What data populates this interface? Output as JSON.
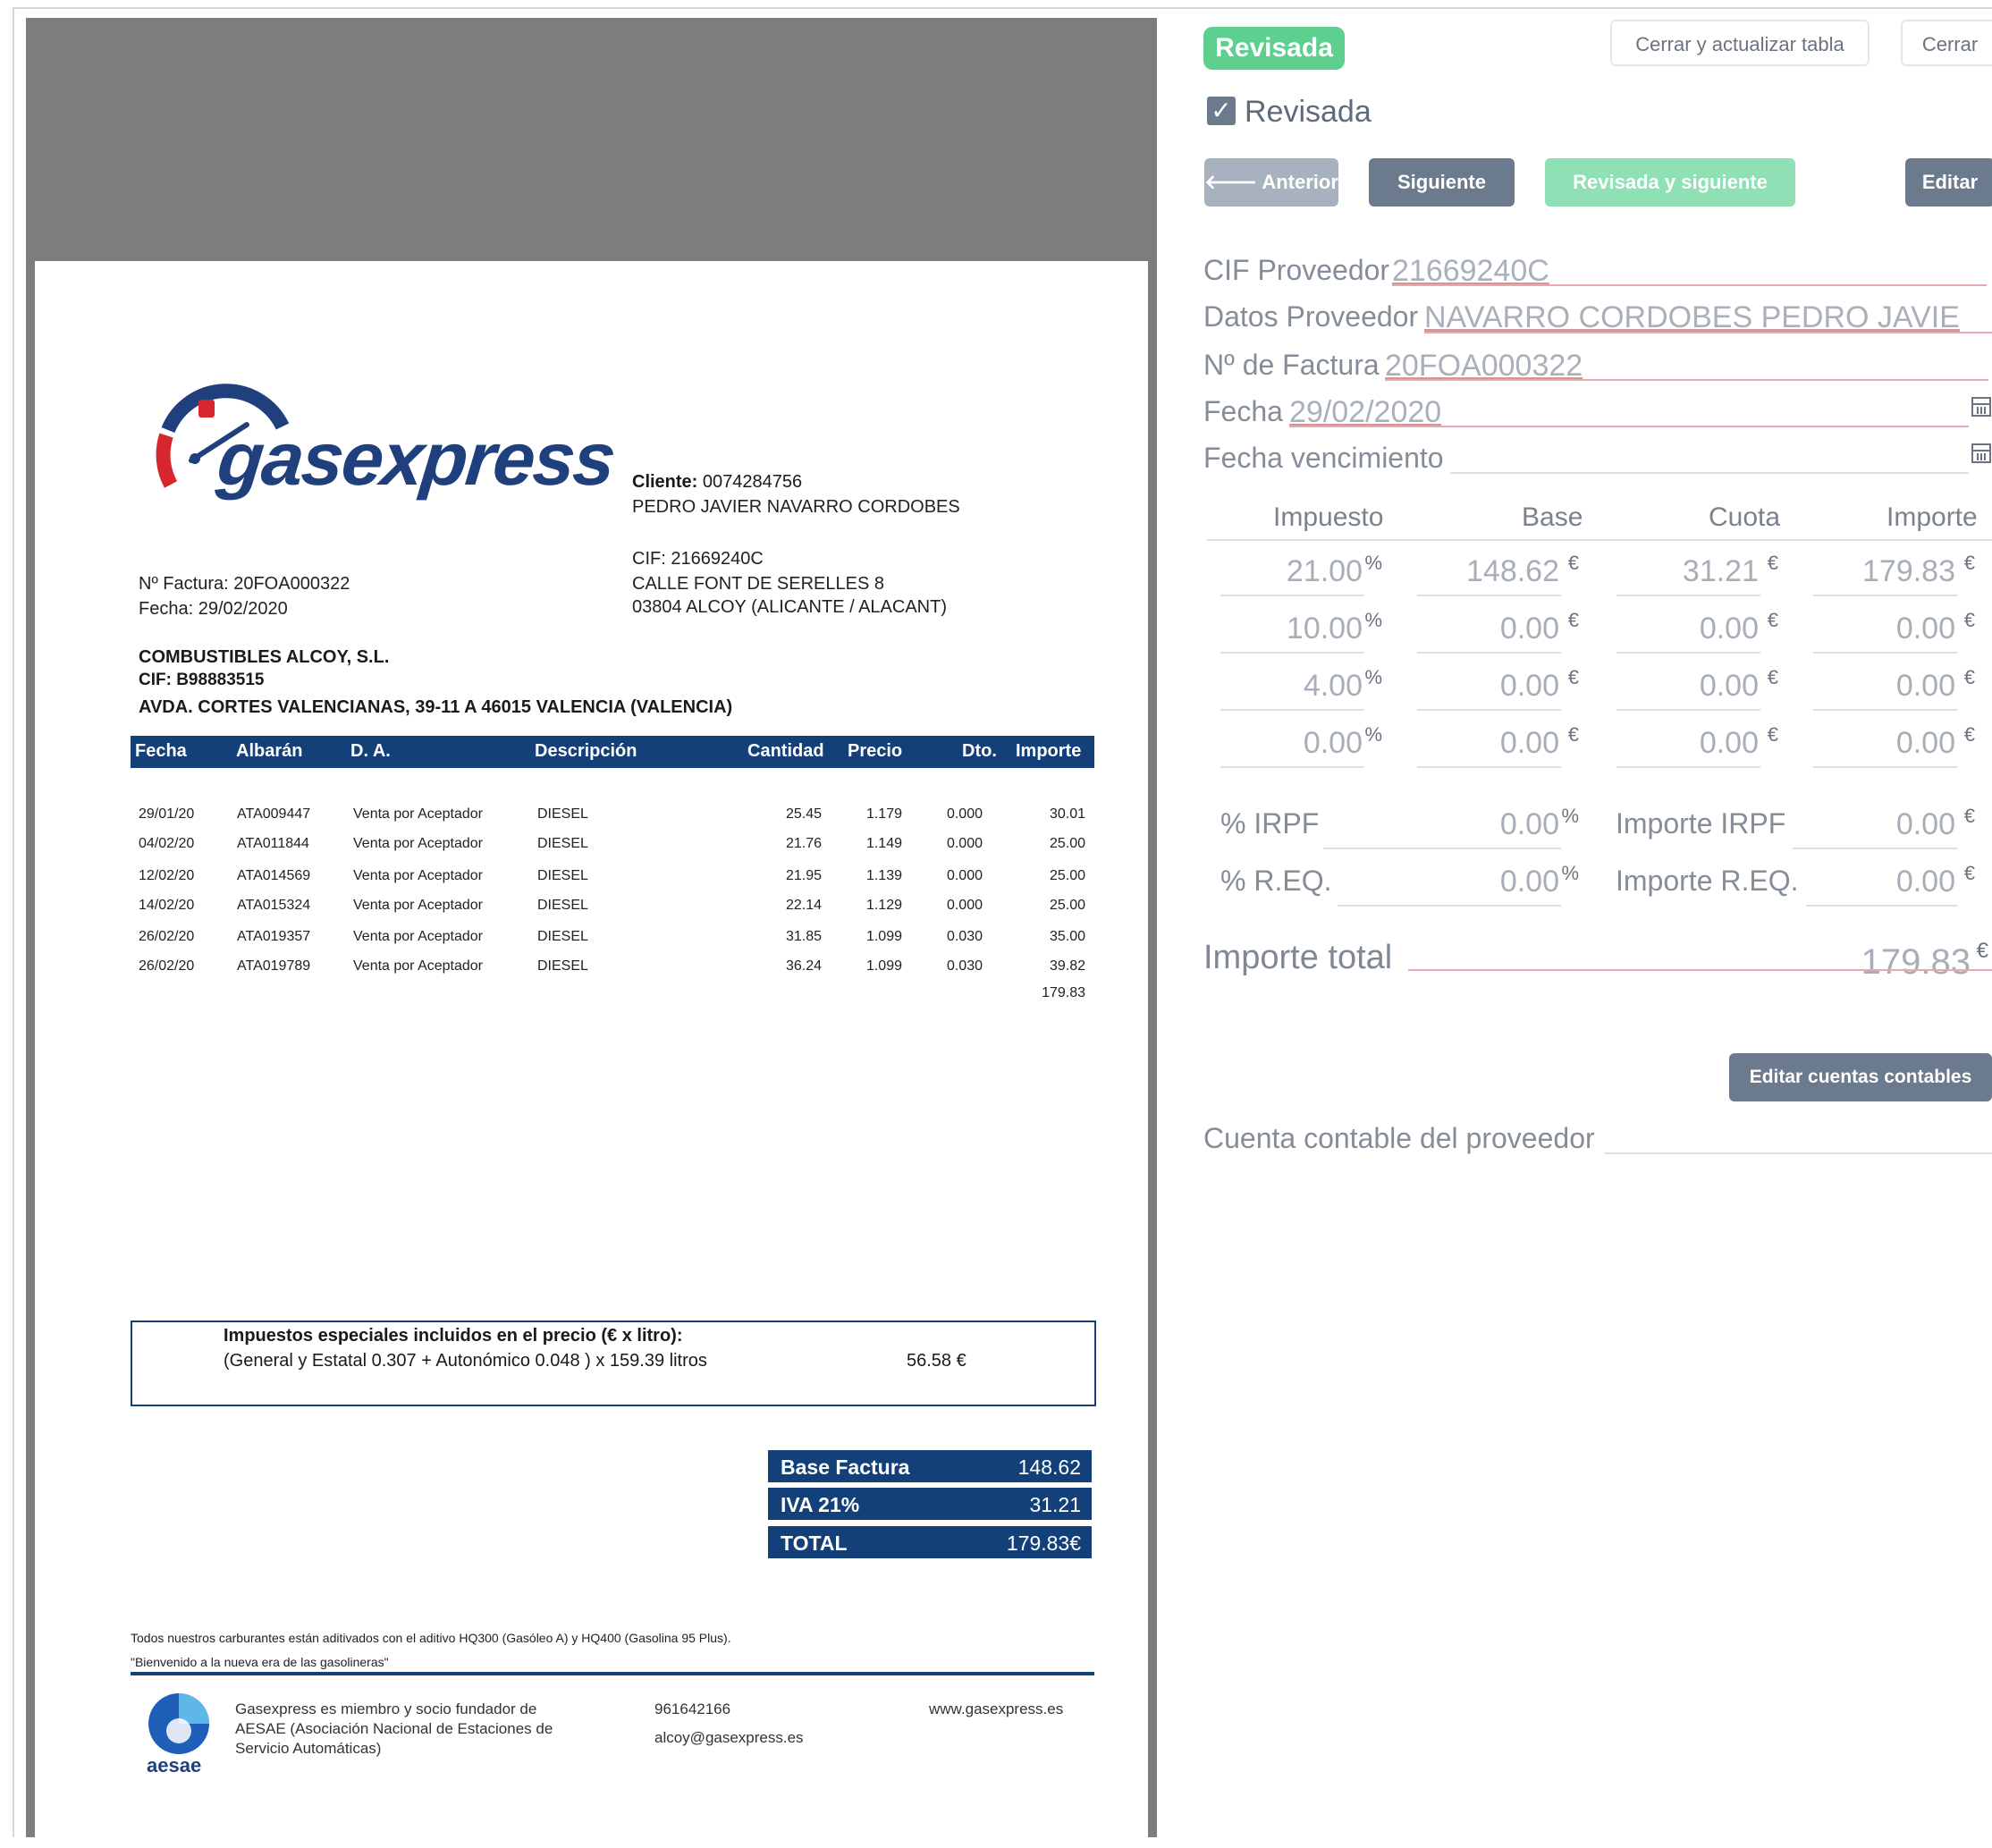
{
  "invoice": {
    "cliente_label": "Cliente:",
    "cliente_code": "0074284756",
    "client_name": "PEDRO JAVIER NAVARRO CORDOBES",
    "client_cif": "CIF: 21669240C",
    "client_addr1": "CALLE FONT DE SERELLES 8",
    "client_addr2": "03804 ALCOY (ALICANTE / ALACANT)",
    "num_factura": "Nº Factura: 20FOA000322",
    "fecha": "Fecha: 29/02/2020",
    "company_name": "COMBUSTIBLES ALCOY, S.L.",
    "company_cif": "CIF: B98883515",
    "company_addr": "AVDA. CORTES VALENCIANAS, 39-11 A 46015 VALENCIA (VALENCIA)",
    "table_headers": [
      "Fecha",
      "Albarán",
      "D. A.",
      "Descripción",
      "Cantidad",
      "Precio",
      "Dto.",
      "Importe"
    ],
    "rows": [
      [
        "29/01/20",
        "ATA009447",
        "Venta por Aceptador",
        "DIESEL",
        "25.45",
        "1.179",
        "0.000",
        "30.01"
      ],
      [
        "04/02/20",
        "ATA011844",
        "Venta por Aceptador",
        "DIESEL",
        "21.76",
        "1.149",
        "0.000",
        "25.00"
      ],
      [
        "12/02/20",
        "ATA014569",
        "Venta por Aceptador",
        "DIESEL",
        "21.95",
        "1.139",
        "0.000",
        "25.00"
      ],
      [
        "14/02/20",
        "ATA015324",
        "Venta por Aceptador",
        "DIESEL",
        "22.14",
        "1.129",
        "0.000",
        "25.00"
      ],
      [
        "26/02/20",
        "ATA019357",
        "Venta por Aceptador",
        "DIESEL",
        "31.85",
        "1.099",
        "0.030",
        "35.00"
      ],
      [
        "26/02/20",
        "ATA019789",
        "Venta por Aceptador",
        "DIESEL",
        "36.24",
        "1.099",
        "0.030",
        "39.82"
      ]
    ],
    "subtotal": "179.83",
    "tax_title": "Impuestos especiales incluidos en el precio (€ x litro):",
    "tax_detail": "(General y Estatal 0.307 + Autonómico 0.048 ) x 159.39 litros",
    "tax_amount": "56.58 €",
    "base_label": "Base Factura",
    "base_value": "148.62",
    "iva_label": "IVA 21%",
    "iva_value": "31.21",
    "total_label": "TOTAL",
    "total_value": "179.83€",
    "footnote1": "Todos nuestros carburantes están aditivados con el aditivo HQ300 (Gasóleo A) y HQ400 (Gasolina 95 Plus).",
    "footnote2": "\"Bienvenido a la nueva era de las gasolineras\"",
    "aesae_text1": "Gasexpress es miembro y socio fundador de",
    "aesae_text2": "AESAE (Asociación Nacional de Estaciones de",
    "aesae_text3": "Servicio Automáticas)",
    "aesae_logo": "aesae",
    "phone": "961642166",
    "email": "alcoy@gasexpress.es",
    "web": "www.gasexpress.es",
    "logo_text": "gasexpress"
  },
  "panel": {
    "status_badge": "Revisada",
    "btn_close_refresh": "Cerrar y actualizar tabla",
    "btn_close": "Cerrar",
    "checkbox_label": "Revisada",
    "btn_prev": "🡐 Anterior",
    "btn_next": "Siguiente 🡒",
    "btn_reviewed_next": "Revisada y siguiente 🡒",
    "btn_edit": "Editar",
    "fields": {
      "cif_label": "CIF Proveedor",
      "cif_value": "21669240C",
      "datos_label": "Datos Proveedor",
      "datos_value": "NAVARRO CORDOBES PEDRO JAVIE",
      "factura_label": "Nº de Factura",
      "factura_value": "20FOA000322",
      "fecha_label": "Fecha",
      "fecha_value": "29/02/2020",
      "venc_label": "Fecha vencimiento",
      "venc_value": ""
    },
    "tax_headers": [
      "Impuesto",
      "Base",
      "Cuota",
      "Importe"
    ],
    "tax_rows": [
      [
        "21.00",
        "148.62",
        "31.21",
        "179.83"
      ],
      [
        "10.00",
        "0.00",
        "0.00",
        "0.00"
      ],
      [
        "4.00",
        "0.00",
        "0.00",
        "0.00"
      ],
      [
        "0.00",
        "0.00",
        "0.00",
        "0.00"
      ]
    ],
    "pct_unit": "%",
    "eur_unit": "€",
    "irpf_label": "% IRPF",
    "irpf_value": "0.00",
    "irpf_imp_label": "Importe IRPF",
    "irpf_imp_value": "0.00",
    "req_label": "% R.EQ.",
    "req_value": "0.00",
    "req_imp_label": "Importe R.EQ.",
    "req_imp_value": "0.00",
    "total_label": "Importe total",
    "total_value": "179.83",
    "btn_edit_accounts": "Editar cuentas contables",
    "supplier_account_label": "Cuenta contable del proveedor",
    "supplier_account_value": ""
  },
  "colors": {
    "invoice_blue": "#14407a",
    "badge_green": "#5dcf8f",
    "btn_slate": "#6b7a8c",
    "btn_light_slate": "#a7b2be",
    "btn_light_green": "#8fe0b4",
    "error_underline": "#e7a9ae"
  },
  "icons": [
    "checkbox-checked-icon",
    "arrow-left-icon",
    "arrow-right-icon",
    "calendar-icon",
    "gasexpress-logo",
    "aesae-logo"
  ]
}
